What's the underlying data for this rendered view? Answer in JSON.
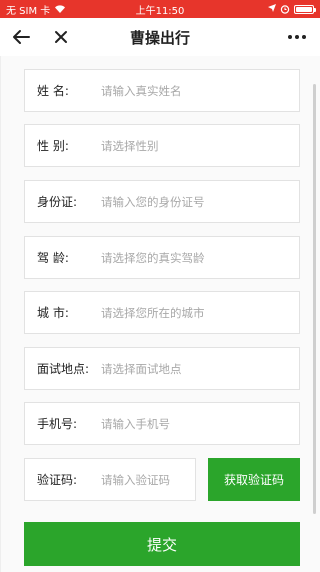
{
  "status_bar": {
    "carrier": "无 SIM 卡",
    "time": "上午11:50",
    "battery_level": 1.0
  },
  "nav": {
    "title": "曹操出行",
    "back_icon": "arrow-left-icon",
    "close_icon": "close-icon",
    "more_icon": "more-horizontal-icon"
  },
  "form": {
    "name": {
      "label": "姓 名:",
      "placeholder": "请输入真实姓名"
    },
    "gender": {
      "label": "性 别:",
      "placeholder": "请选择性别"
    },
    "id_card": {
      "label": "身份证:",
      "placeholder": "请输入您的身份证号"
    },
    "driving_years": {
      "label": "驾 龄:",
      "placeholder": "请选择您的真实驾龄"
    },
    "city": {
      "label": "城 市:",
      "placeholder": "请选择您所在的城市"
    },
    "interview_location": {
      "label": "面试地点:",
      "placeholder": "请选择面试地点"
    },
    "phone": {
      "label": "手机号:",
      "placeholder": "请输入手机号"
    },
    "code": {
      "label": "验证码:",
      "placeholder": "请输入验证码"
    },
    "get_code_label": "获取验证码",
    "submit_label": "提交"
  },
  "colors": {
    "status_bar": "#e7352b",
    "primary_green": "#2ba52b",
    "placeholder": "#a8a8a8"
  }
}
